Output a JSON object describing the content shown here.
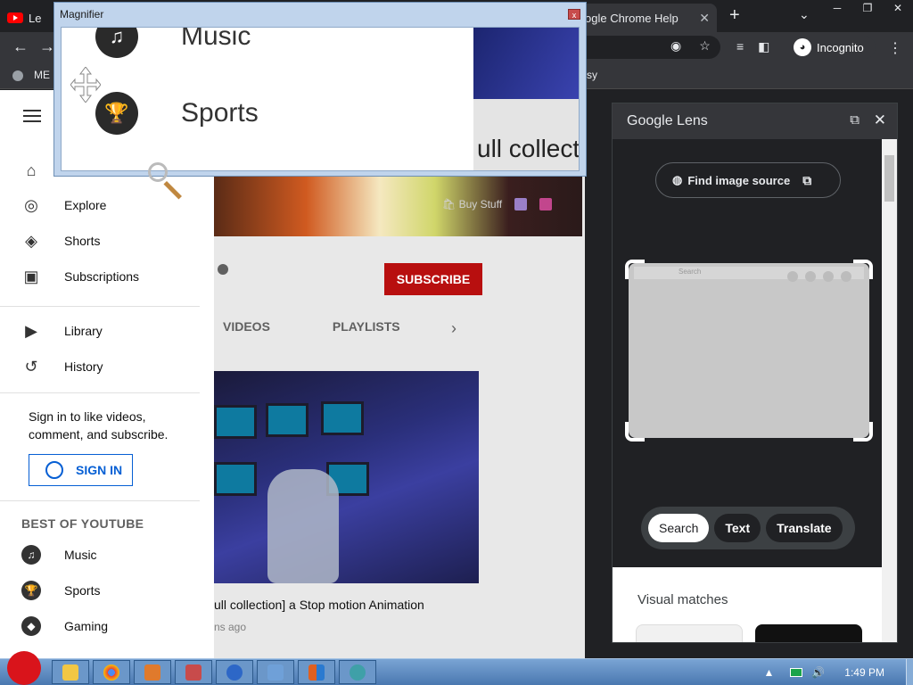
{
  "browser": {
    "tabs": [
      {
        "label": "Le",
        "icon": "youtube-icon"
      },
      {
        "label": "ogle Chrome Help",
        "close": "✕"
      }
    ],
    "new_tab": "+",
    "tab_search": "⌄",
    "window_controls": [
      "─",
      "❐",
      "✕"
    ],
    "nav": {
      "back": "←",
      "forward": "→"
    },
    "incognito_label": "Incognito",
    "menu_glyph": "⋮",
    "bookmarks": {
      "left_label": "ME",
      "right_label": "sy"
    }
  },
  "youtube": {
    "sidebar": {
      "primary": [
        {
          "label": "Explore",
          "icon": "compass-icon",
          "glyph": "◎"
        },
        {
          "label": "Shorts",
          "icon": "shorts-icon",
          "glyph": "◈"
        },
        {
          "label": "Subscriptions",
          "icon": "subscriptions-icon",
          "glyph": "▣"
        }
      ],
      "secondary": [
        {
          "label": "Library",
          "icon": "library-icon",
          "glyph": "▶"
        },
        {
          "label": "History",
          "icon": "history-icon",
          "glyph": "↺"
        }
      ],
      "home_icon": "⌂",
      "signin_prompt": "Sign in to like videos, comment, and subscribe.",
      "signin_button": "SIGN IN",
      "best_of_title": "BEST OF YOUTUBE",
      "best_of": [
        {
          "label": "Music",
          "icon": "music-icon",
          "glyph": "♫"
        },
        {
          "label": "Sports",
          "icon": "trophy-icon",
          "glyph": "🏆"
        },
        {
          "label": "Gaming",
          "icon": "gaming-icon",
          "glyph": "◆"
        }
      ]
    },
    "channel": {
      "banner_links": {
        "buy_stuff": "Buy Stuff"
      },
      "subscribe": "SUBSCRIBE",
      "tabs": [
        "VIDEOS",
        "PLAYLISTS"
      ],
      "tabs_next": "›"
    },
    "video": {
      "title": "ull collection] a Stop motion Animation",
      "meta": "ns ago"
    }
  },
  "lens": {
    "title": "Google Lens",
    "open_new": "⧉",
    "close": "✕",
    "find_source": "Find image source",
    "crop_search_placeholder": "Search",
    "modes": [
      {
        "label": "Search",
        "active": true
      },
      {
        "label": "Text",
        "active": false
      },
      {
        "label": "Translate",
        "active": false
      }
    ],
    "visual_matches": "Visual matches"
  },
  "magnifier": {
    "title": "Magnifier",
    "close": "x",
    "items": [
      {
        "label": "Music",
        "glyph": "♫"
      },
      {
        "label": "Sports",
        "glyph": "🏆"
      }
    ],
    "right_text": "ull collect"
  },
  "taskbar": {
    "apps": [
      "folder",
      "chrome",
      "paint",
      "media",
      "help",
      "network",
      "office",
      "globe"
    ],
    "tray_up": "▲",
    "clock": "1:49 PM"
  },
  "colors": {
    "subscribe": "#b80f0f",
    "signin_blue": "#065fd4",
    "chrome_dark": "#202124"
  }
}
